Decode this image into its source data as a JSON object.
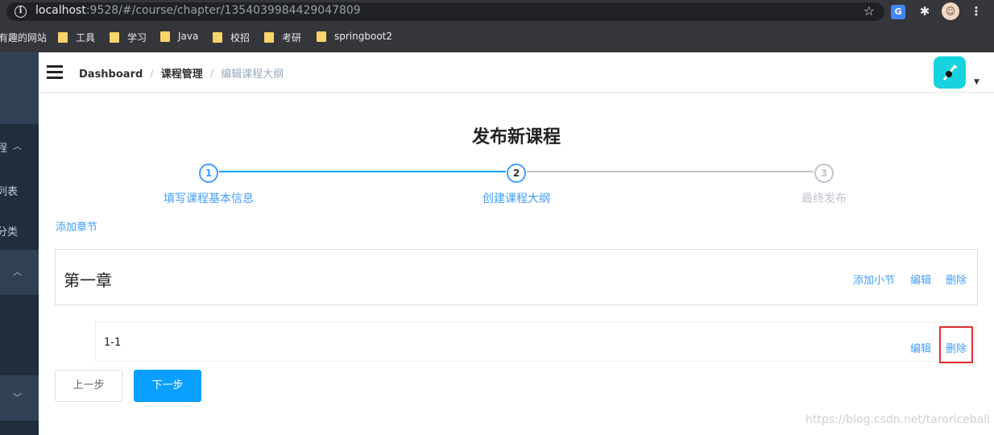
{
  "browser": {
    "url_host": "localhost",
    "url_rest": ":9528/#/course/chapter/1354039984429047809",
    "bookmarks": [
      "有趣的网站",
      "工具",
      "学习",
      "Java",
      "校招",
      "考研",
      "springboot2"
    ],
    "ext_label": "G"
  },
  "sidebar": {
    "items": [
      {
        "label": "程",
        "chevron": "︿"
      },
      {
        "label": "列表"
      },
      {
        "label": "分类"
      },
      {
        "chevron": "︿"
      },
      {
        "chevron": "﹀"
      }
    ]
  },
  "navbar": {
    "breadcrumb": [
      "Dashboard",
      "课程管理",
      "编辑课程大纲"
    ],
    "separator": "/"
  },
  "page": {
    "title": "发布新课程",
    "steps": [
      {
        "number": "1",
        "label": "填写课程基本信息",
        "state": "done"
      },
      {
        "number": "2",
        "label": "创建课程大纲",
        "state": "active"
      },
      {
        "number": "3",
        "label": "最终发布",
        "state": "pending"
      }
    ],
    "add_chapter": "添加章节",
    "chapters": [
      {
        "title": "第一章",
        "actions": [
          "添加小节",
          "编辑",
          "删除"
        ],
        "sections": [
          {
            "title": "1-1",
            "actions": [
              "编辑",
              "删除"
            ]
          }
        ]
      }
    ],
    "prev_button": "上一步",
    "next_button": "下一步"
  },
  "watermark": "https://blog.csdn.net/taroriceball",
  "colors": {
    "accent": "#409eff",
    "primary_button": "#0b9fff",
    "sidebar_bg": "#304156",
    "highlight_box": "#e03030"
  }
}
